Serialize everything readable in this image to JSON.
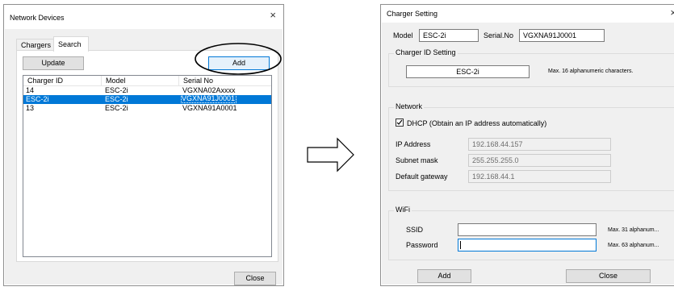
{
  "network_devices": {
    "title": "Network Devices",
    "close_glyph": "×",
    "tabs": [
      "Chargers",
      "Search"
    ],
    "update_label": "Update",
    "add_label": "Add",
    "columns": [
      "Charger ID",
      "Model",
      "Serial No"
    ],
    "rows": [
      {
        "id": "14",
        "model": "ESC-2i",
        "serial": "VGXNA02Axxxx"
      },
      {
        "id": "ESC-2i",
        "model": "ESC-2i",
        "serial": "VGXNA91J0001"
      },
      {
        "id": "13",
        "model": "ESC-2i",
        "serial": "VGXNA91A0001"
      }
    ],
    "selected_row": 1,
    "close_label": "Close"
  },
  "charger_setting": {
    "title": "Charger Setting",
    "close_glyph": "×",
    "model_label": "Model",
    "model_value": "ESC-2i",
    "serial_label": "Serial.No",
    "serial_value": "VGXNA91J0001",
    "id_group_title": "Charger ID Setting",
    "charger_id_value": "ESC-2i",
    "id_hint": "Max. 16 alphanumeric characters.",
    "network_group_title": "Network",
    "dhcp_label": "DHCP (Obtain an IP address automatically)",
    "dhcp_checked": true,
    "ip_label": "IP Address",
    "ip_value": "192.168.44.157",
    "subnet_label": "Subnet mask",
    "subnet_value": "255.255.255.0",
    "gateway_label": "Default gateway",
    "gateway_value": "192.168.44.1",
    "wifi_group_title": "WiFi",
    "ssid_label": "SSID",
    "ssid_value": "",
    "ssid_hint": "Max. 31 alphanum...",
    "password_label": "Password",
    "password_value": "",
    "password_hint": "Max. 63 alphanum...",
    "add_label": "Add",
    "close_label": "Close"
  },
  "colors": {
    "selection": "#0078d7",
    "focus_border": "#0078d7",
    "button_face": "#e1e1e1",
    "dialog_client": "#f0f0f0"
  }
}
